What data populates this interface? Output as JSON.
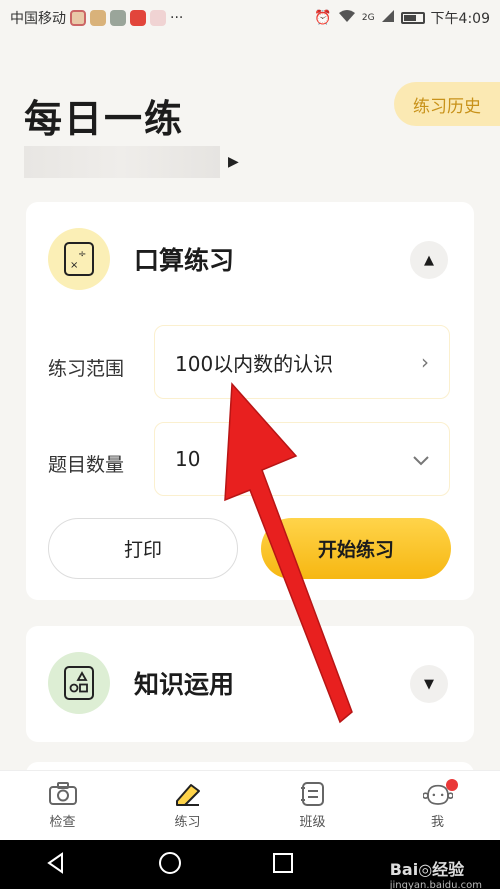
{
  "status_bar": {
    "carrier": "中国移动",
    "extra": "···",
    "network": "2G",
    "time": "下午4:09"
  },
  "header": {
    "title": "每日一练",
    "history_button": "练习历史"
  },
  "card_oral": {
    "title": "口算练习",
    "range_label": "练习范围",
    "range_value": "100以内数的认识",
    "count_label": "题目数量",
    "count_value": "10",
    "print_button": "打印",
    "start_button": "开始练习"
  },
  "card_knowledge": {
    "title": "知识运用"
  },
  "tabs": [
    {
      "label": "检查",
      "icon": "camera-icon"
    },
    {
      "label": "练习",
      "icon": "pencil-icon"
    },
    {
      "label": "班级",
      "icon": "class-list-icon"
    },
    {
      "label": "我",
      "icon": "profile-face-icon"
    }
  ],
  "watermark": {
    "brand": "Bai◎经验",
    "url": "jingyan.baidu.com"
  },
  "colors": {
    "accent_yellow": "#f6b712",
    "history_text": "#c8921a",
    "arrow_red": "#e8201f"
  }
}
